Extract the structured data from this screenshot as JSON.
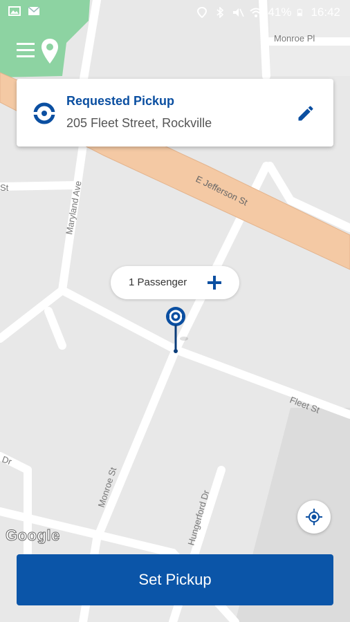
{
  "status_bar": {
    "battery": "41%",
    "time": "16:42",
    "left_icons": [
      "image-icon",
      "email-icon"
    ],
    "right_icons": [
      "location-icon",
      "bluetooth-icon",
      "mute-icon",
      "wifi-icon",
      "battery-icon"
    ]
  },
  "map": {
    "street_labels": {
      "monroe_pl": "Monroe Pl",
      "e_jefferson": "E Jefferson St",
      "maryland": "Maryland Ave",
      "fleet": "Fleet St",
      "monroe_st": "Monroe St",
      "hungerford": "Hungerford Dr",
      "st_left": "St",
      "dr_left": "Dr"
    },
    "attribution": "Google",
    "colors": {
      "road": "#ffffff",
      "highway": "#f4c9a4",
      "park": "#8dd3a2",
      "land": "#e8e8e8"
    }
  },
  "pickup_card": {
    "title": "Requested Pickup",
    "address": "205 Fleet Street, Rockville",
    "icon": "target-ring-icon",
    "edit_icon": "pencil-icon"
  },
  "passengers": {
    "label": "1 Passenger",
    "add_icon": "plus-icon"
  },
  "actions": {
    "set_pickup": "Set Pickup"
  },
  "accent": "#0b55a8"
}
